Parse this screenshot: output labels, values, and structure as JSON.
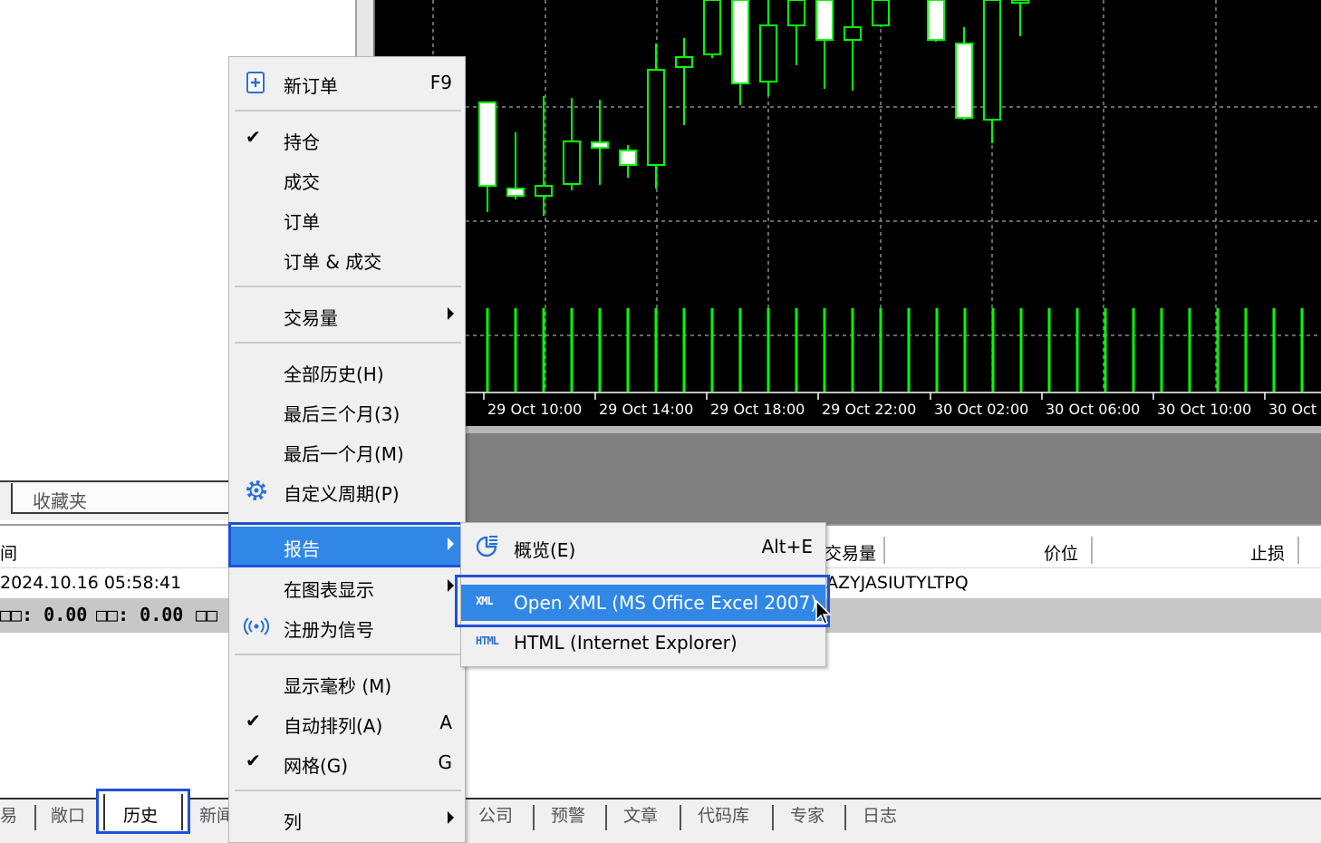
{
  "navigator": {
    "favorites_tab": "收藏夹"
  },
  "chart": {
    "time_labels": [
      "29 Oct 10:00",
      "29 Oct 14:00",
      "29 Oct 18:00",
      "29 Oct 22:00",
      "30 Oct 02:00",
      "30 Oct 06:00",
      "30 Oct 10:00",
      "30 Oct"
    ],
    "colors": {
      "background": "#000000",
      "candle": "#00ff00",
      "bull_body": "#ffffff",
      "grid": "#8a8a8a"
    }
  },
  "terminal": {
    "header": {
      "col_first_fragment": "间",
      "col_volume_fragment": "交易量",
      "col_price": "价位",
      "col_stop_loss": "止损"
    },
    "row": {
      "time": "2024.10.16 05:58:41",
      "comment_fragment": "AZYJASIUTYLTPQ"
    },
    "summary": {
      "item1": "□□: 0.00",
      "item2": "□□: 0.00",
      "item3": "□□"
    }
  },
  "tabs": [
    "易",
    "敞口",
    "历史",
    "新闻",
    "公司",
    "预警",
    "文章",
    "代码库",
    "专家",
    "日志"
  ],
  "context_menu": {
    "new_order": {
      "label": "新订单",
      "shortcut": "F9"
    },
    "positions": {
      "label": "持仓",
      "checked": true
    },
    "deals": {
      "label": "成交"
    },
    "orders": {
      "label": "订单"
    },
    "orders_deals": {
      "label": "订单 & 成交"
    },
    "volume": {
      "label": "交易量"
    },
    "all_history": {
      "label": "全部历史(H)"
    },
    "last_3_months": {
      "label": "最后三个月(3)"
    },
    "last_month": {
      "label": "最后一个月(M)"
    },
    "custom_period": {
      "label": "自定义周期(P)"
    },
    "report": {
      "label": "报告"
    },
    "show_on_chart": {
      "label": "在图表显示"
    },
    "register_signal": {
      "label": "注册为信号"
    },
    "show_ms": {
      "label": "显示毫秒 (M)"
    },
    "auto_arrange": {
      "label": "自动排列(A)",
      "shortcut": "A",
      "checked": true
    },
    "grid": {
      "label": "网格(G)",
      "shortcut": "G",
      "checked": true
    },
    "columns": {
      "label": "列"
    }
  },
  "report_submenu": {
    "overview": {
      "label": "概览(E)",
      "shortcut": "Alt+E"
    },
    "open_xml": {
      "badge": "XML",
      "label": "Open XML (MS Office Excel 2007)"
    },
    "html": {
      "badge": "HTML",
      "label": "HTML (Internet Explorer)"
    }
  }
}
